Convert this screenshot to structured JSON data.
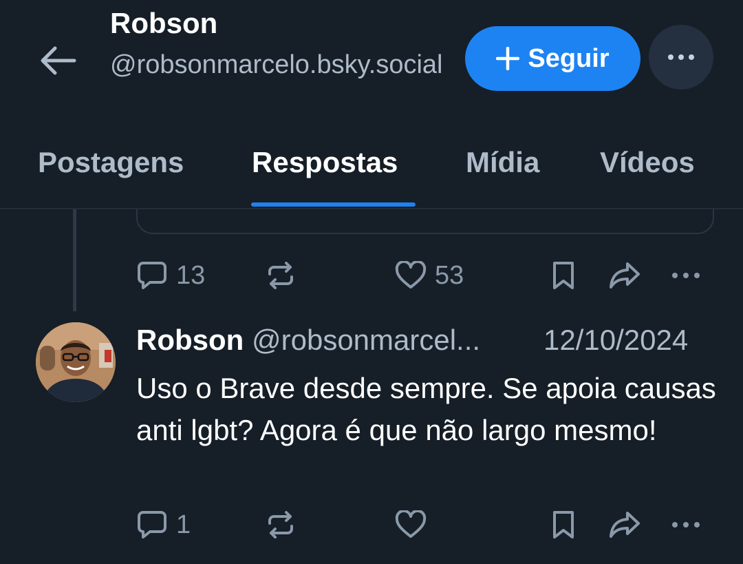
{
  "profile": {
    "name": "Robson",
    "handle": "@robsonmarcelo.bsky.social",
    "follow_label": "Seguir"
  },
  "tabs": [
    {
      "label": "Postagens",
      "active": false
    },
    {
      "label": "Respostas",
      "active": true
    },
    {
      "label": "Mídia",
      "active": false
    },
    {
      "label": "Vídeos",
      "active": false
    }
  ],
  "previous_post": {
    "reply_count": "13",
    "like_count": "53"
  },
  "post": {
    "author": "Robson",
    "handle": "@robsonmarcel...",
    "date": "12/10/2024",
    "text": "Uso o Brave desde sempre. Se apoia causas anti lgbt? Agora é que não largo mesmo!",
    "reply_count": "1"
  },
  "colors": {
    "background": "#161e27",
    "accent": "#1d83f3",
    "muted_text": "#aebbc9",
    "icon": "#8a99aa"
  }
}
